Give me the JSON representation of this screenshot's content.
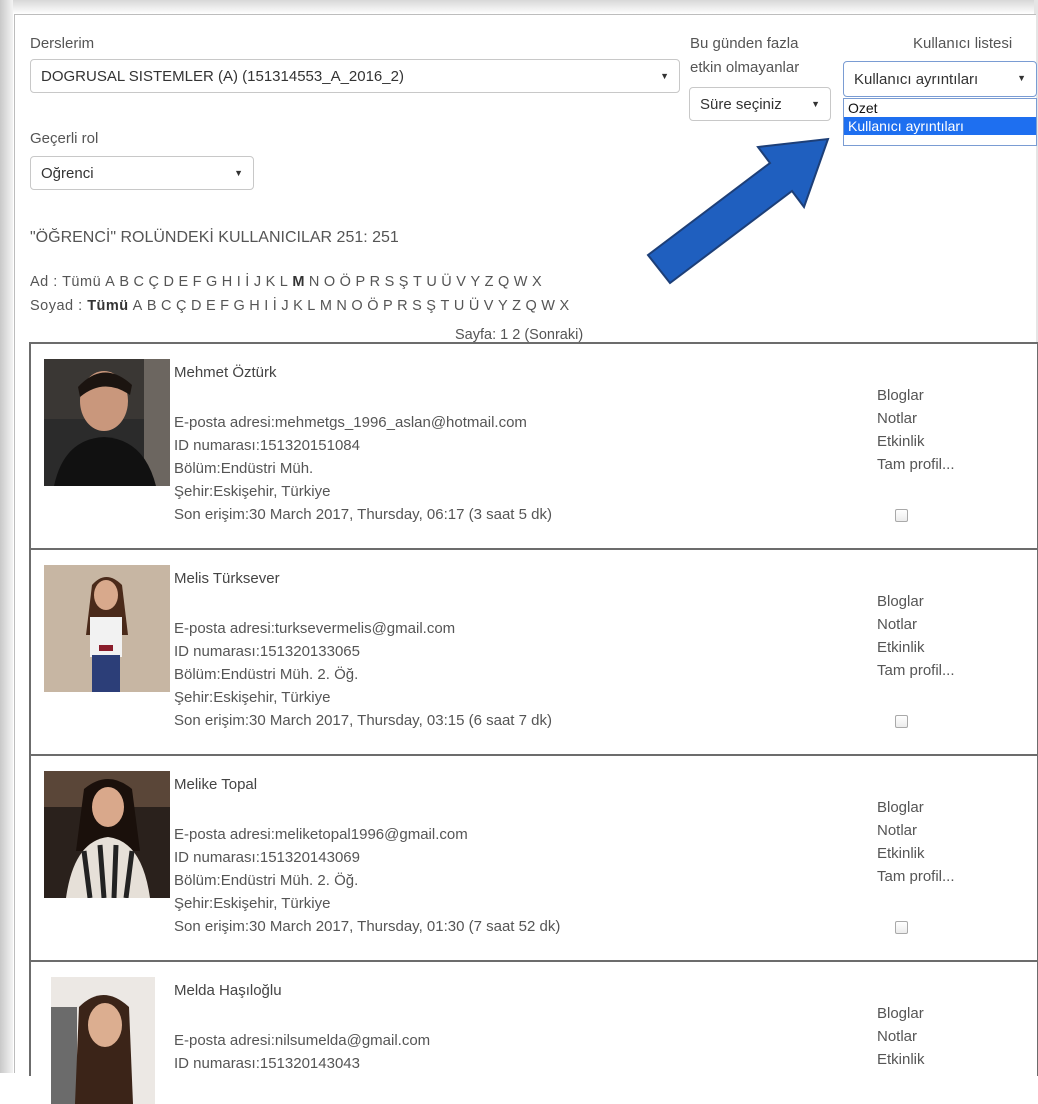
{
  "filters": {
    "courses_label": "Derslerim",
    "course_value": "DOGRUSAL SISTEMLER (A) (151314553_A_2016_2)",
    "inactive_label_line1": "Bu günden fazla",
    "inactive_label_line2": "etkin olmayanlar",
    "inactive_value": "Süre seçiniz",
    "userlist_label": "Kullanıcı listesi",
    "userlist_value": "Kullanıcı ayrıntıları",
    "userlist_options": [
      "Ozet",
      "Kullanıcı ayrıntıları"
    ],
    "role_label": "Geçerli rol",
    "role_value": "Oğrenci"
  },
  "heading": "\"ÖĞRENCİ\" ROLÜNDEKİ KULLANICILAR 251: 251",
  "alphabet": {
    "first_label": "Ad :",
    "last_label": "Soyad :",
    "all": "Tümü",
    "letters": [
      "A",
      "B",
      "C",
      "Ç",
      "D",
      "E",
      "F",
      "G",
      "H",
      "I",
      "İ",
      "J",
      "K",
      "L",
      "M",
      "N",
      "O",
      "Ö",
      "P",
      "R",
      "S",
      "Ş",
      "T",
      "U",
      "Ü",
      "V",
      "Y",
      "Z",
      "Q",
      "W",
      "X"
    ]
  },
  "paging": "Sayfa: 1 2 (Sonraki)",
  "links": {
    "blogs": "Bloglar",
    "notes": "Notlar",
    "activity": "Etkinlik",
    "profile": "Tam profil..."
  },
  "labels": {
    "email": "E-posta adresi:",
    "id": "ID numarası:",
    "dept": "Bölüm:",
    "city": "Şehir:",
    "last_access": "Son erişim:"
  },
  "users": [
    {
      "name": "Mehmet Öztürk",
      "email": "mehmetgs_1996_aslan@hotmail.com",
      "id": "151320151084",
      "dept": "Endüstri Müh.",
      "city": "Eskişehir, Türkiye",
      "last_access": "30 March 2017, Thursday, 06:17  (3 saat 5 dk)"
    },
    {
      "name": "Melis Türksever",
      "email": "turksevermelis@gmail.com",
      "id": "151320133065",
      "dept": "Endüstri Müh. 2. Öğ.",
      "city": "Eskişehir, Türkiye",
      "last_access": "30 March 2017, Thursday, 03:15  (6 saat 7 dk)"
    },
    {
      "name": "Melike Topal",
      "email": "meliketopal1996@gmail.com",
      "id": "151320143069",
      "dept": "Endüstri Müh. 2. Öğ.",
      "city": "Eskişehir, Türkiye",
      "last_access": "30 March 2017, Thursday, 01:30  (7 saat 52 dk)"
    },
    {
      "name": "Melda Haşıloğlu",
      "email": "nilsumelda@gmail.com",
      "id": "151320143043"
    }
  ],
  "colors": {
    "arrow": "#1f5fbf",
    "arrow_stroke": "#1d3f78",
    "highlight": "#1e6ff0"
  }
}
